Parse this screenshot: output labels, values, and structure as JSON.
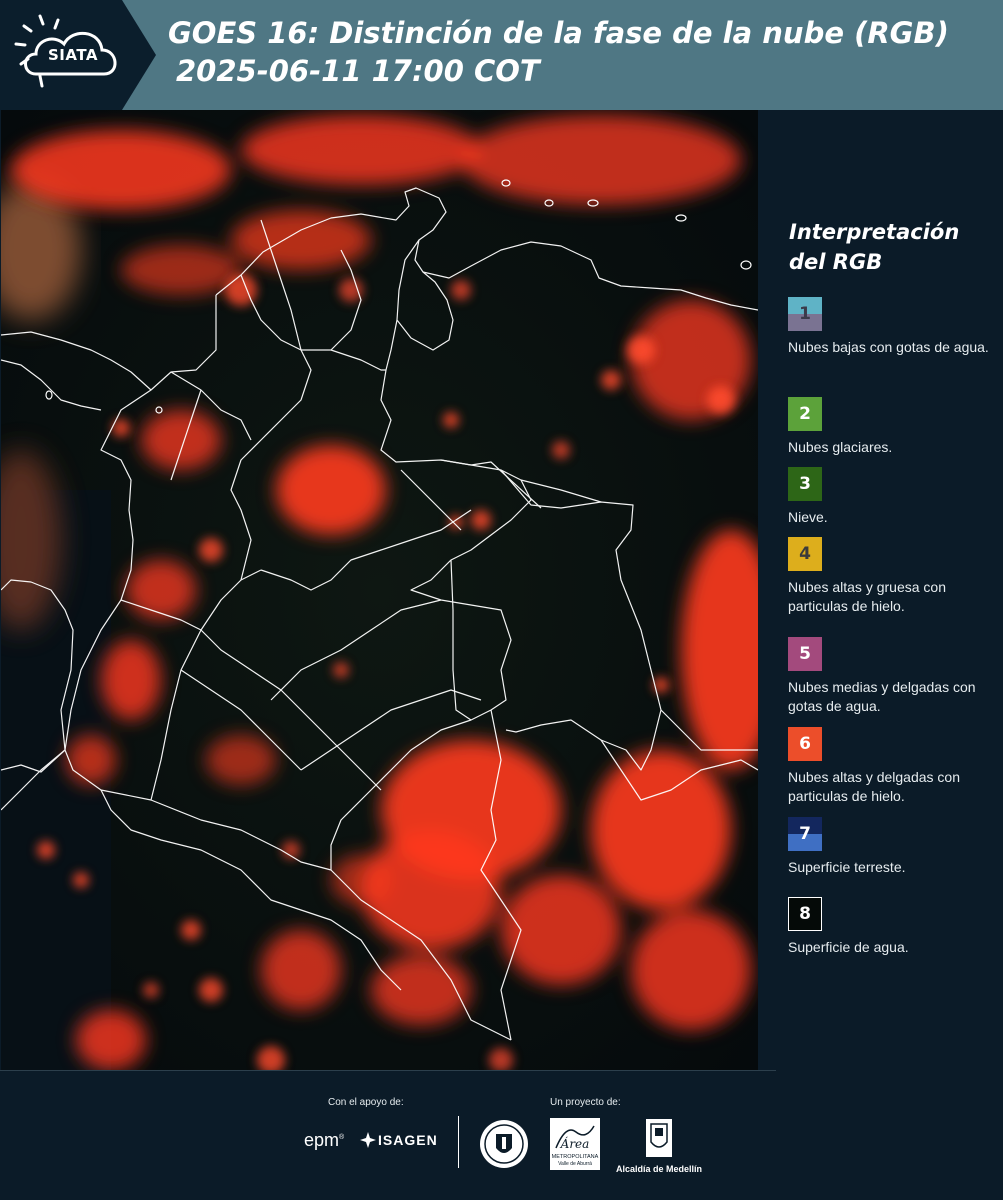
{
  "header": {
    "logo_text": "SIATA",
    "title_line1": "GOES 16: Distinción de la fase de la nube (RGB)",
    "title_line2": "2025-06-11 17:00 COT"
  },
  "legend": {
    "title": "Interpretación del RGB",
    "items": [
      {
        "number": "1",
        "label": "Nubes bajas con gotas de agua.",
        "color_top": "#5fb3c6",
        "color_bottom": "#7a7392",
        "text_color": "#3b3b4a"
      },
      {
        "number": "2",
        "label": "Nubes glaciares.",
        "color_top": "#5ca23a",
        "color_bottom": "#5ca23a",
        "text_color": "#ffffff"
      },
      {
        "number": "3",
        "label": "Nieve.",
        "color_top": "#2d6617",
        "color_bottom": "#2d6617",
        "text_color": "#ffffff"
      },
      {
        "number": "4",
        "label": "Nubes altas y gruesa con particulas de hielo.",
        "color_top": "#ddae1c",
        "color_bottom": "#ddae1c",
        "text_color": "#3b3b3b"
      },
      {
        "number": "5",
        "label": "Nubes medias y delgadas con gotas de agua.",
        "color_top": "#a34a7d",
        "color_bottom": "#a34a7d",
        "text_color": "#ffffff"
      },
      {
        "number": "6",
        "label": "Nubes altas y delgadas con particulas de hielo.",
        "color_top": "#ec4e2a",
        "color_bottom": "#ec4e2a",
        "text_color": "#ffffff"
      },
      {
        "number": "7",
        "label": "Superficie terreste.",
        "color_top": "#13275e",
        "color_bottom": "#3f6fc3",
        "text_color": "#ffffff"
      },
      {
        "number": "8",
        "label": "Superficie de agua.",
        "color_top": "#050a08",
        "color_bottom": "#050a08",
        "text_color": "#ffffff"
      }
    ]
  },
  "footer": {
    "support_label": "Con el apoyo de:",
    "project_label": "Un proyecto de:",
    "epm": "epm",
    "isagen": "ISAGEN",
    "area_text": "Área",
    "area_sub": "METROPOLITANA",
    "area_sub2": "Valle de Aburrá",
    "alcaldia": "Alcaldía de Medellín"
  },
  "colors": {
    "header_bg": "#4f7784",
    "panel_bg": "#0b1b28",
    "cloud_red": "#ff3a1f",
    "border_white": "#ffffff"
  }
}
